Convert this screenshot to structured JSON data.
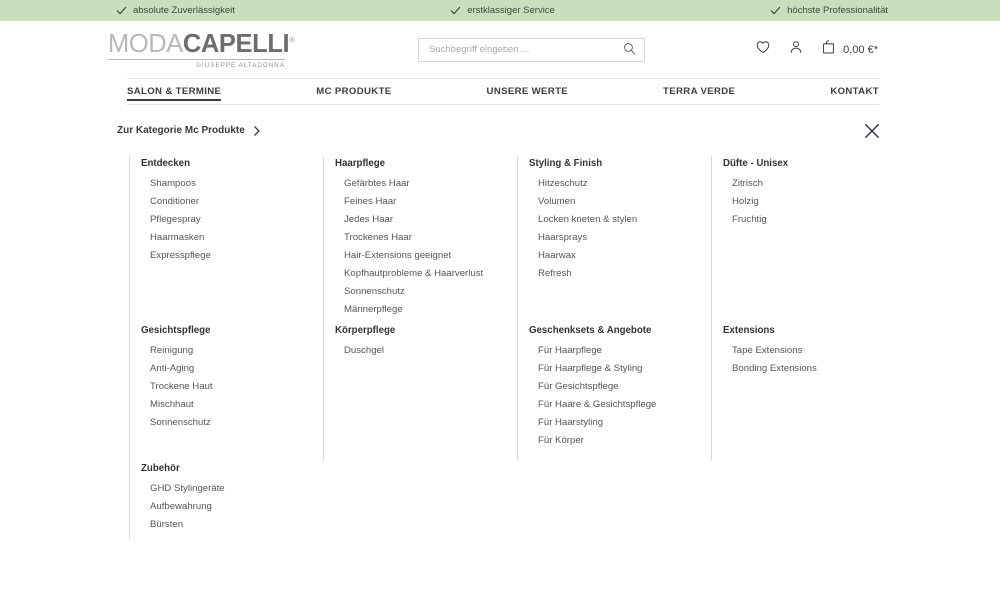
{
  "usp_bar": {
    "items": [
      {
        "icon": "check-icon",
        "label": "absolute Zuverlässigkeit"
      },
      {
        "icon": "check-icon",
        "label": "erstklassiger Service"
      },
      {
        "icon": "check-icon",
        "label": "höchste Professionalität"
      }
    ],
    "background_color": "#c8dfbc"
  },
  "header": {
    "logo": {
      "part1": "MODA",
      "part2": "CAPELLI",
      "trademark": "®",
      "subtitle": "GIUSEPPE ALTADONNA"
    },
    "search": {
      "placeholder": "Suchbegriff eingeben ...",
      "value": "",
      "icon": "search-icon"
    },
    "actions": {
      "wishlist_icon": "heart-icon",
      "account_icon": "user-icon",
      "cart_icon": "bag-icon",
      "cart_amount": "0,00 €*"
    }
  },
  "mainnav": {
    "items": [
      {
        "label": "SALON & TERMINE",
        "active": true
      },
      {
        "label": "MC PRODUKTE",
        "active": false
      },
      {
        "label": "UNSERE WERTE",
        "active": false
      },
      {
        "label": "TERRA VERDE",
        "active": false
      },
      {
        "label": "KONTAKT",
        "active": false
      }
    ]
  },
  "flyout": {
    "breadcrumb_label": "Zur Kategorie Mc Produkte",
    "breadcrumb_icon": "chevron-right-icon",
    "close_icon": "close-icon",
    "columns": [
      {
        "title": "Entdecken",
        "items": [
          "Shampoos",
          "Conditioner",
          "Pflegespray",
          "Haarmasken",
          "Expresspflege"
        ]
      },
      {
        "title": "Haarpflege",
        "items": [
          "Gefärbtes Haar",
          "Feines Haar",
          "Jedes Haar",
          "Trockenes Haar",
          "Hair-Extensions geeignet",
          "Kopfhautprobleme & Haarverlust",
          "Sonnenschutz",
          "Männerpflege"
        ]
      },
      {
        "title": "Styling & Finish",
        "items": [
          "Hitzeschutz",
          "Volumen",
          "Locken kneten & stylen",
          "Haarsprays",
          "Haarwax",
          "Refresh"
        ]
      },
      {
        "title": "Düfte - Unisex",
        "items": [
          "Zitrisch",
          "Holzig",
          "Fruchtig"
        ]
      },
      {
        "title": "Gesichtspflege",
        "items": [
          "Reinigung",
          "Anti-Aging",
          "Trockene Haut",
          "Mischhaut",
          "Sonnenschutz"
        ]
      },
      {
        "title": "Körperpflege",
        "items": [
          "Duschgel"
        ]
      },
      {
        "title": "Geschenksets & Angebote",
        "items": [
          "Für Haarpflege",
          "Für Haarpflege & Styling",
          "Für Gesichtspflege",
          "Für Haare & Gesichtspflege",
          "Für Haarstyling",
          "Für Körper"
        ]
      },
      {
        "title": "Extensions",
        "items": [
          "Tape Extensions",
          "Bonding Extensions"
        ]
      },
      {
        "title": "Zubehör",
        "items": [
          "GHD Stylingeräte",
          "Aufbewahrung",
          "Bürsten"
        ]
      }
    ]
  }
}
